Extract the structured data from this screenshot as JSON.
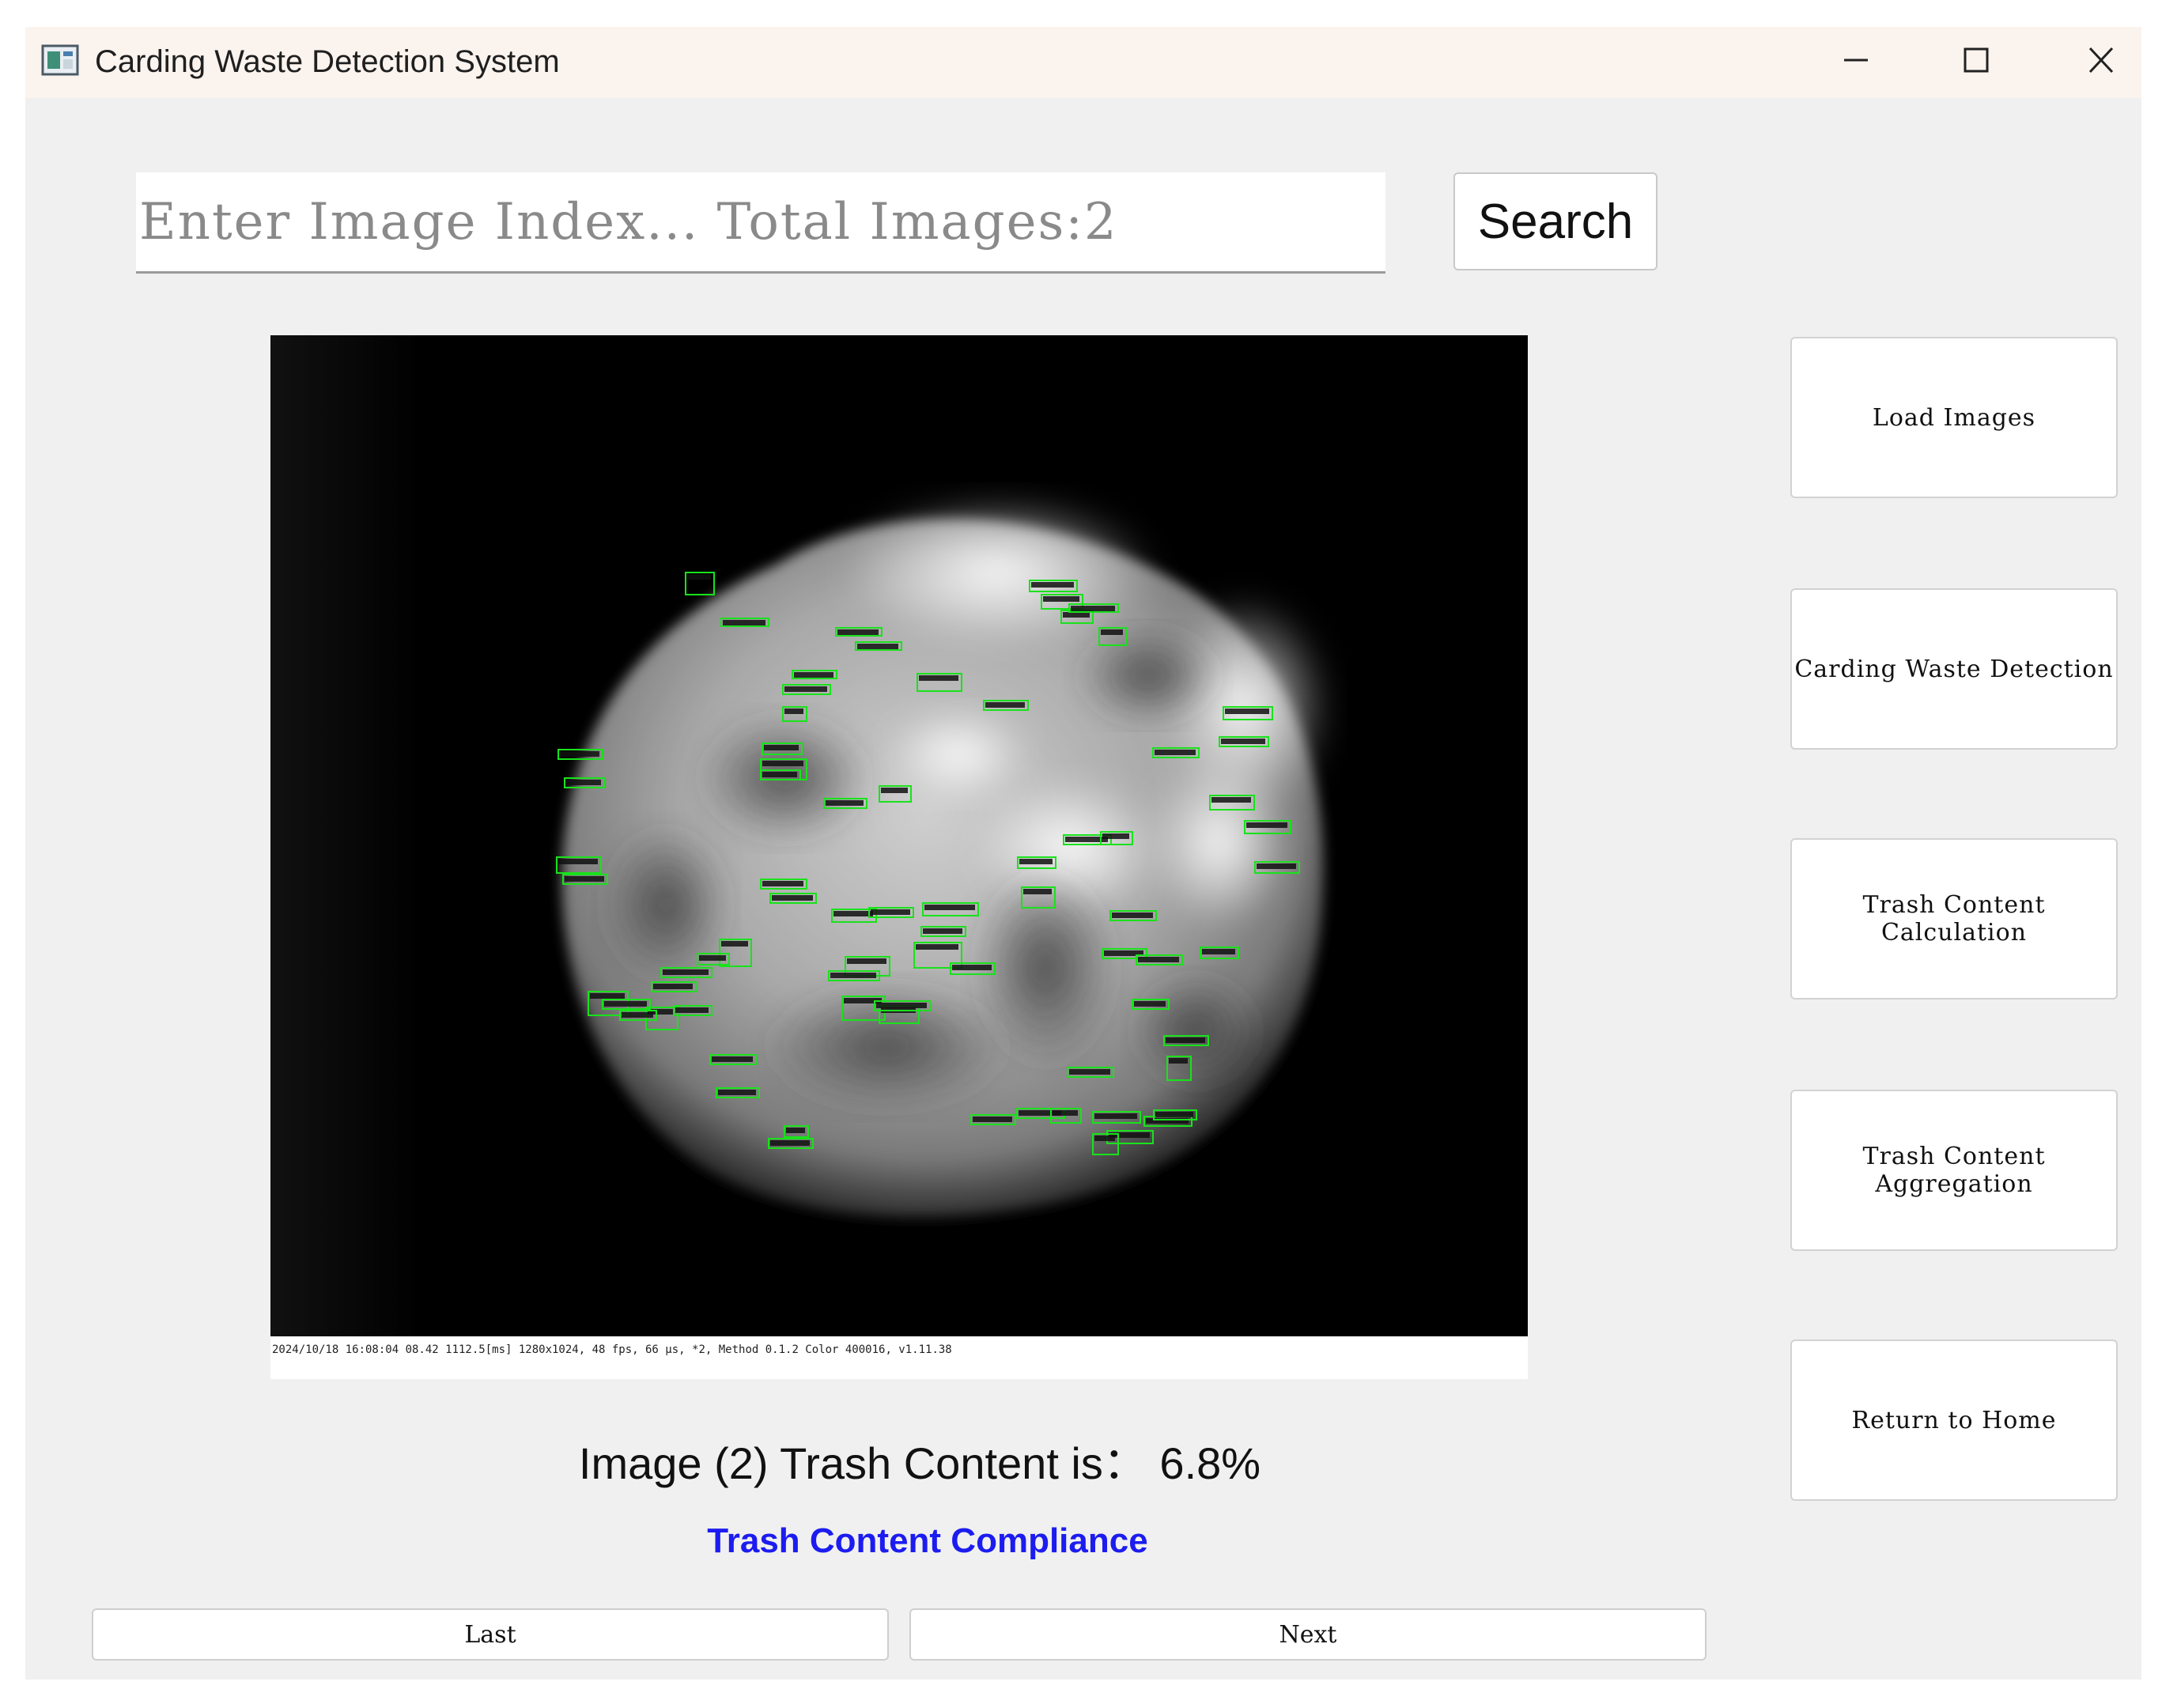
{
  "window": {
    "title": "Carding Waste Detection System",
    "title_icon": "app-window-icon",
    "controls": [
      "minimize-icon",
      "maximize-icon",
      "close-icon"
    ]
  },
  "search": {
    "placeholder": "Enter Image Index... Total Images:2",
    "button_label": "Search"
  },
  "image_viewer": {
    "footer_caption": "2024/10/18 16:08:04 08.42  1112.5[ms] 1280x1024, 48 fps, 66 μs, *2, Method 0.1.2 Color 400016, v1.11.38",
    "detection_color": "#19e21b"
  },
  "result": {
    "trash_content_text": "Image (2) Trash Content is：  6.8%",
    "compliance_text": "Trash Content Compliance",
    "compliance_color": "#1c1cf0"
  },
  "navigation": {
    "last_label": "Last",
    "next_label": "Next"
  },
  "sidebar": {
    "buttons": [
      {
        "label": "Load Images"
      },
      {
        "label": "Carding Waste Detection"
      },
      {
        "label": "Trash Content Calculation"
      },
      {
        "label": "Trash Content Aggregation"
      },
      {
        "label": "Return to Home"
      }
    ]
  }
}
